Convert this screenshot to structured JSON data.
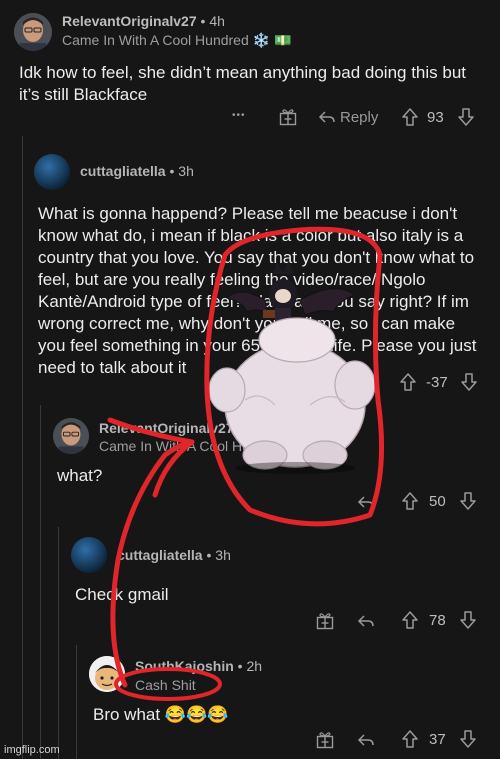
{
  "comments": [
    {
      "username": "RelevantOriginalv27",
      "time": "4h",
      "flair": "Came In With A Cool Hundred",
      "text": "Idk how to feel, she didn’t mean anything bad doing this but it’s still Blackface",
      "reply_label": "Reply",
      "score": "93"
    },
    {
      "username": "cuttagliatella",
      "time": "3h",
      "text": "What is gonna happend? Please tell me beacuse i don't know what do, i mean if black is a color but also italy is a country that you love. You say that you don't know what to feel, but are you really feeling the video/race/ Ngolo Kantè/Android type of feel? Blackface you say right? If im wrong correct me, why don't you call me, so i can make you feel something in your 65 years of life. Please you just need to talk about it",
      "score": "-37"
    },
    {
      "username": "RelevantOriginalv27",
      "flair": "Came In With A Cool Hundred",
      "text": "what?",
      "score": "50"
    },
    {
      "username": "cuttagliatella",
      "time": "3h",
      "text": "Check gmail",
      "score": "78"
    },
    {
      "username": "SouthKajoshin",
      "time": "2h",
      "flair": "Cash Shit",
      "text": "Bro what 😂😂😂",
      "score": "37"
    }
  ],
  "meta_separator": "•",
  "more_glyph": "•••",
  "flair_emoji": "❄️ 💵",
  "watermark": "imgflip.com",
  "colors": {
    "background": "#161616",
    "annotation": "#e0262b"
  }
}
